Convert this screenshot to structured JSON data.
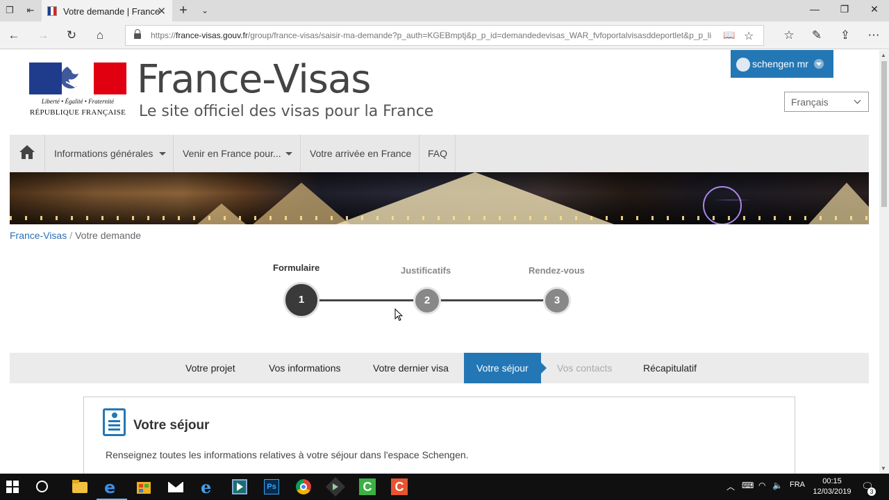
{
  "browser": {
    "tab_title": "Votre demande | France",
    "url_prefix": "https://",
    "url_domain": "france-visas.gouv.fr",
    "url_rest": "/group/france-visas/saisir-ma-demande?p_auth=KGEBmptj&p_p_id=demandedevisas_WAR_fvfoportalvisasddeportlet&p_p_li"
  },
  "header": {
    "motto": "Liberté • Égalité • Fraternité",
    "republic": "RÉPUBLIQUE FRANÇAISE",
    "site_title": "France-Visas",
    "site_subtitle": "Le site officiel des visas pour la France",
    "user_name": "schengen mr",
    "language": "Français"
  },
  "colors": {
    "accent": "#2477b5",
    "flag_blue": "#1f3c8c",
    "flag_red": "#e1000f"
  },
  "nav": {
    "items": [
      {
        "label": "Informations générales",
        "dropdown": true
      },
      {
        "label": "Venir en France pour...",
        "dropdown": true
      },
      {
        "label": "Votre arrivée en France",
        "dropdown": false
      },
      {
        "label": "FAQ",
        "dropdown": false
      }
    ]
  },
  "breadcrumb": {
    "root": "France-Visas",
    "separator": "/",
    "current": "Votre demande"
  },
  "stepper": {
    "steps": [
      {
        "number": "1",
        "label": "Formulaire",
        "state": "current"
      },
      {
        "number": "2",
        "label": "Justificatifs",
        "state": "pending"
      },
      {
        "number": "3",
        "label": "Rendez-vous",
        "state": "pending"
      }
    ]
  },
  "subnav": {
    "items": [
      {
        "label": "Votre projet",
        "state": "done"
      },
      {
        "label": "Vos informations",
        "state": "done"
      },
      {
        "label": "Votre dernier visa",
        "state": "done"
      },
      {
        "label": "Votre séjour",
        "state": "active"
      },
      {
        "label": "Vos contacts",
        "state": "disabled"
      },
      {
        "label": "Récapitulatif",
        "state": "normal"
      }
    ]
  },
  "section": {
    "title": "Votre séjour",
    "description": "Renseignez toutes les informations relatives à votre séjour dans l'espace Schengen."
  },
  "taskbar": {
    "language": "FRA",
    "time": "00:15",
    "date": "12/03/2019",
    "notifications": "3"
  }
}
